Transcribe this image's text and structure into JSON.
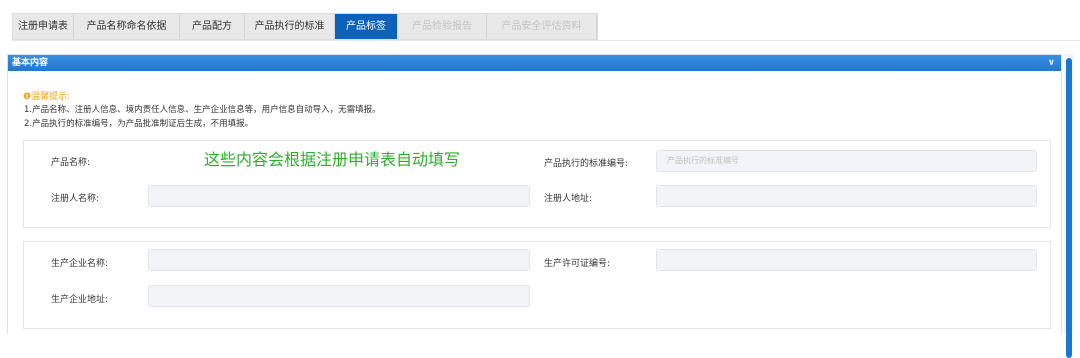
{
  "tabs": [
    {
      "label": "注册申请表",
      "state": "normal"
    },
    {
      "label": "产品名称命名依据",
      "state": "normal"
    },
    {
      "label": "产品配方",
      "state": "normal"
    },
    {
      "label": "产品执行的标准",
      "state": "normal"
    },
    {
      "label": "产品标签",
      "state": "active"
    },
    {
      "label": "产品检验报告",
      "state": "disabled"
    },
    {
      "label": "产品安全评估资料",
      "state": "disabled"
    }
  ],
  "panel": {
    "title": "基本内容",
    "toggle_icon": "chevron-down-icon"
  },
  "tips": {
    "title": "❶温馨提示:",
    "line1": "1.产品名称、注册人信息、境内责任人信息、生产企业信息等，用户信息自动导入，无需填报。",
    "line2": "2.产品执行的标准编号，为产品批准制证后生成，不用填报。"
  },
  "annotation": "这些内容会根据注册申请表自动填写",
  "section1": {
    "product_name_label": "产品名称:",
    "product_name_value": "",
    "standard_no_label": "产品执行的标准编号:",
    "standard_no_placeholder": "产品执行的标准编号",
    "registrant_name_label": "注册人名称:",
    "registrant_name_value": "",
    "registrant_address_label": "注册人地址:",
    "registrant_address_value": ""
  },
  "section2": {
    "manufacturer_name_label": "生产企业名称:",
    "manufacturer_name_value": "",
    "license_no_label": "生产许可证编号:",
    "license_no_value": "",
    "manufacturer_address_label": "生产企业地址:",
    "manufacturer_address_value": ""
  },
  "colors": {
    "active_tab": "#0b62b8",
    "panel_header": "#1f78d1",
    "tip_title": "#f2a21c",
    "annotation": "#2daf2d"
  }
}
